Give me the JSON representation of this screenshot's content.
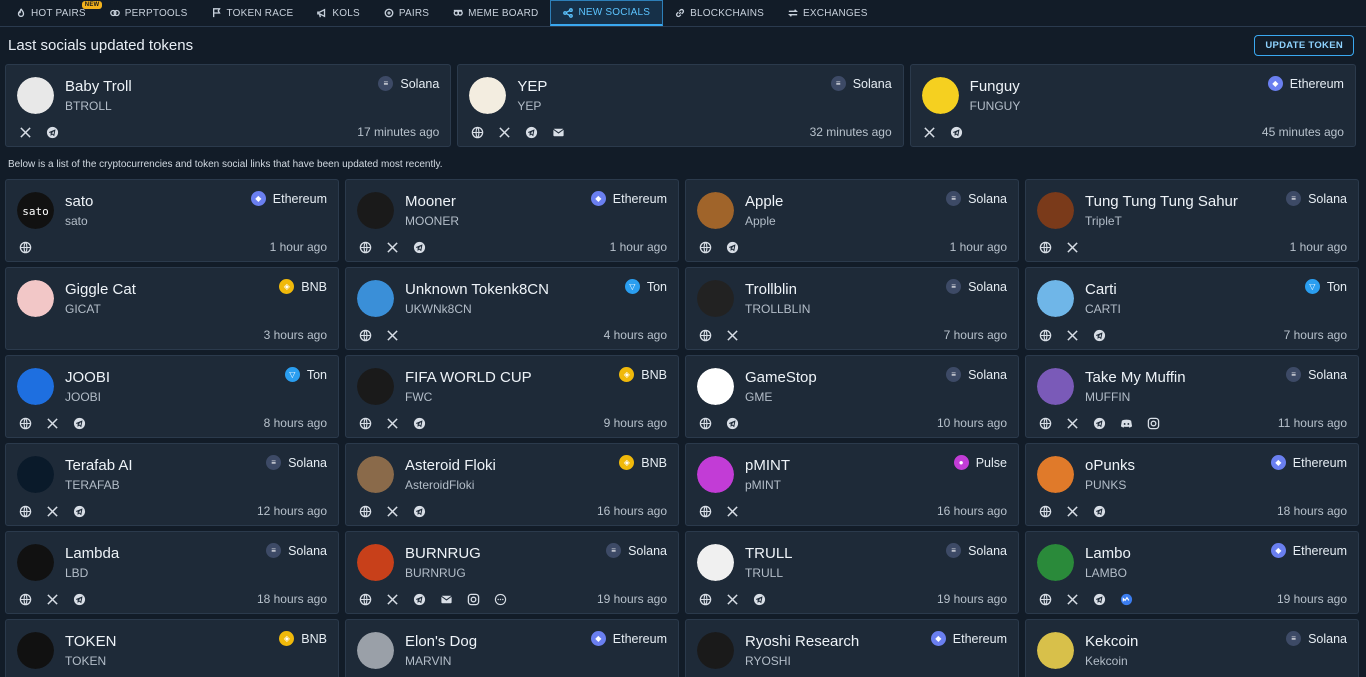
{
  "nav": [
    {
      "label": "HOT PAIRS",
      "icon": "flame-icon",
      "active": false
    },
    {
      "label": "PERPTOOLS",
      "icon": "perp-icon",
      "active": false,
      "badge": "NEW"
    },
    {
      "label": "TOKEN RACE",
      "icon": "flag-icon",
      "active": false
    },
    {
      "label": "KOLS",
      "icon": "megaphone-icon",
      "active": false
    },
    {
      "label": "PAIRS",
      "icon": "pairs-icon",
      "active": false
    },
    {
      "label": "MEME BOARD",
      "icon": "meme-icon",
      "active": false
    },
    {
      "label": "NEW SOCIALS",
      "icon": "share-icon",
      "active": true
    },
    {
      "label": "BLOCKCHAINS",
      "icon": "link-icon",
      "active": false
    },
    {
      "label": "EXCHANGES",
      "icon": "exchange-icon",
      "active": false
    }
  ],
  "header": {
    "title": "Last socials updated tokens",
    "update_button": "UPDATE TOKEN"
  },
  "note": "Below is a list of the cryptocurrencies and token social links that have been updated most recently.",
  "chain_colors": {
    "Solana": "#3d4a66",
    "Ethereum": "#6a7ff0",
    "BNB": "#f0b90b",
    "Ton": "#2a9ef0",
    "Pulse": "#c23cd6"
  },
  "featured": [
    {
      "name": "Baby Troll",
      "symbol": "BTROLL",
      "chain": "Solana",
      "links": [
        "x",
        "telegram"
      ],
      "time": "17 minutes ago",
      "avatar": "#e8e8e8"
    },
    {
      "name": "YEP",
      "symbol": "YEP",
      "chain": "Solana",
      "links": [
        "web",
        "x",
        "telegram",
        "email"
      ],
      "time": "32 minutes ago",
      "avatar": "#f3ede0"
    },
    {
      "name": "Funguy",
      "symbol": "FUNGUY",
      "chain": "Ethereum",
      "links": [
        "x",
        "telegram"
      ],
      "time": "45 minutes ago",
      "avatar": "#f5d020"
    }
  ],
  "tokens": [
    {
      "name": "sato",
      "symbol": "sato",
      "chain": "Ethereum",
      "links": [
        "web"
      ],
      "time": "1 hour ago",
      "avatar": "#111111",
      "avatar_text": "sato"
    },
    {
      "name": "Mooner",
      "symbol": "MOONER",
      "chain": "Ethereum",
      "links": [
        "web",
        "x",
        "telegram"
      ],
      "time": "1 hour ago",
      "avatar": "#1a1a1a"
    },
    {
      "name": "Apple",
      "symbol": "Apple",
      "chain": "Solana",
      "links": [
        "web",
        "telegram"
      ],
      "time": "1 hour ago",
      "avatar": "#a0642a"
    },
    {
      "name": "Tung Tung Tung Sahur",
      "symbol": "TripleT",
      "chain": "Solana",
      "links": [
        "web",
        "x"
      ],
      "time": "1 hour ago",
      "avatar": "#7a3a1a"
    },
    {
      "name": "Giggle Cat",
      "symbol": "GICAT",
      "chain": "BNB",
      "links": [],
      "time": "3 hours ago",
      "avatar": "#f2c7c7"
    },
    {
      "name": "Unknown Tokenk8CN",
      "symbol": "UKWNk8CN",
      "chain": "Ton",
      "links": [
        "web",
        "x"
      ],
      "time": "4 hours ago",
      "avatar": "#3a8fd8"
    },
    {
      "name": "Trollblin",
      "symbol": "TROLLBLIN",
      "chain": "Solana",
      "links": [
        "web",
        "x"
      ],
      "time": "7 hours ago",
      "avatar": "#222222"
    },
    {
      "name": "Carti",
      "symbol": "CARTI",
      "chain": "Ton",
      "links": [
        "web",
        "x",
        "telegram"
      ],
      "time": "7 hours ago",
      "avatar": "#6fb6e8"
    },
    {
      "name": "JOOBI",
      "symbol": "JOOBI",
      "chain": "Ton",
      "links": [
        "web",
        "x",
        "telegram"
      ],
      "time": "8 hours ago",
      "avatar": "#1e6fe0"
    },
    {
      "name": "FIFA WORLD CUP",
      "symbol": "FWC",
      "chain": "BNB",
      "links": [
        "web",
        "x",
        "telegram"
      ],
      "time": "9 hours ago",
      "avatar": "#1a1a1a"
    },
    {
      "name": "GameStop",
      "symbol": "GME",
      "chain": "Solana",
      "links": [
        "web",
        "telegram"
      ],
      "time": "10 hours ago",
      "avatar": "#ffffff"
    },
    {
      "name": "Take My Muffin",
      "symbol": "MUFFIN",
      "chain": "Solana",
      "links": [
        "web",
        "x",
        "telegram",
        "discord",
        "instagram"
      ],
      "time": "11 hours ago",
      "avatar": "#7a5ab8"
    },
    {
      "name": "Terafab AI",
      "symbol": "TERAFAB",
      "chain": "Solana",
      "links": [
        "web",
        "x",
        "telegram"
      ],
      "time": "12 hours ago",
      "avatar": "#0a1a2a"
    },
    {
      "name": "Asteroid Floki",
      "symbol": "AsteroidFloki",
      "chain": "BNB",
      "links": [
        "web",
        "x",
        "telegram"
      ],
      "time": "16 hours ago",
      "avatar": "#8a6a4a"
    },
    {
      "name": "pMINT",
      "symbol": "pMINT",
      "chain": "Pulse",
      "links": [
        "web",
        "x"
      ],
      "time": "16 hours ago",
      "avatar": "#c23cd6"
    },
    {
      "name": "oPunks",
      "symbol": "PUNKS",
      "chain": "Ethereum",
      "links": [
        "web",
        "x",
        "telegram"
      ],
      "time": "18 hours ago",
      "avatar": "#e07a2a"
    },
    {
      "name": "Lambda",
      "symbol": "LBD",
      "chain": "Solana",
      "links": [
        "web",
        "x",
        "telegram"
      ],
      "time": "18 hours ago",
      "avatar": "#111111"
    },
    {
      "name": "BURNRUG",
      "symbol": "BURNRUG",
      "chain": "Solana",
      "links": [
        "web",
        "x",
        "telegram",
        "email",
        "instagram",
        "more"
      ],
      "time": "19 hours ago",
      "avatar": "#c8401a"
    },
    {
      "name": "TRULL",
      "symbol": "TRULL",
      "chain": "Solana",
      "links": [
        "web",
        "x",
        "telegram"
      ],
      "time": "19 hours ago",
      "avatar": "#f0f0f0"
    },
    {
      "name": "Lambo",
      "symbol": "LAMBO",
      "chain": "Ethereum",
      "links": [
        "web",
        "x",
        "telegram",
        "coinmarket"
      ],
      "time": "19 hours ago",
      "avatar": "#2a8a3a"
    },
    {
      "name": "TOKEN",
      "symbol": "TOKEN",
      "chain": "BNB",
      "links": [],
      "time": "",
      "avatar": "#111111"
    },
    {
      "name": "Elon's Dog",
      "symbol": "MARVIN",
      "chain": "Ethereum",
      "links": [],
      "time": "",
      "avatar": "#9aa0a8"
    },
    {
      "name": "Ryoshi Research",
      "symbol": "RYOSHI",
      "chain": "Ethereum",
      "links": [],
      "time": "",
      "avatar": "#1a1a1a"
    },
    {
      "name": "Kekcoin",
      "symbol": "Kekcoin",
      "chain": "Solana",
      "links": [],
      "time": "",
      "avatar": "#d8c04a"
    }
  ]
}
